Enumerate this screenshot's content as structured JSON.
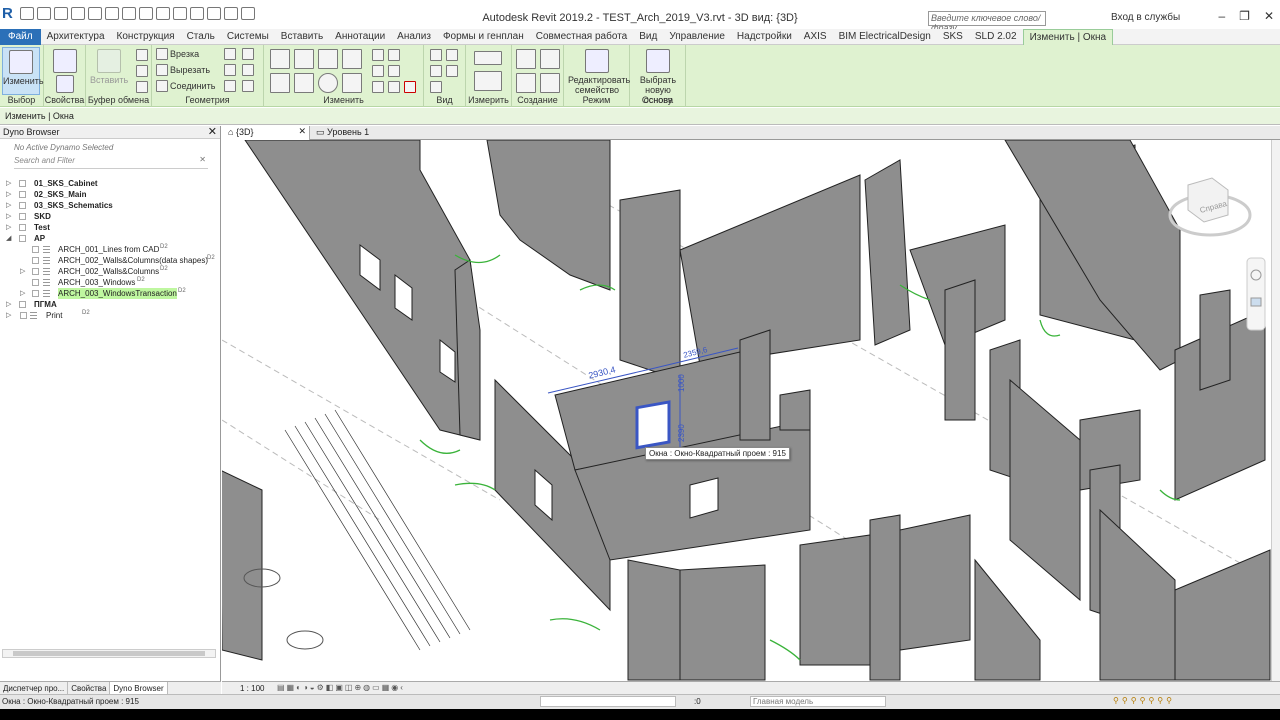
{
  "titlebar": {
    "title": "Autodesk Revit 2019.2 - TEST_Arch_2019_V3.rvt - 3D вид: {3D}",
    "search_placeholder": "Введите ключевое слово/фразу",
    "login": "Вход в службы"
  },
  "tabs": [
    "Файл",
    "Архитектура",
    "Конструкция",
    "Сталь",
    "Системы",
    "Вставить",
    "Аннотации",
    "Анализ",
    "Формы и генплан",
    "Совместная работа",
    "Вид",
    "Управление",
    "Надстройки",
    "AXIS",
    "BIM ElectricalDesign",
    "SKS",
    "SLD 2.02",
    "Изменить | Окна"
  ],
  "ribbon": {
    "modify": "Изменить",
    "select": "Выбор",
    "props": "Свойства",
    "paste": "Вставить",
    "clipboard": "Буфер обмена",
    "cut_join": "Врезка",
    "cut": "Вырезать",
    "join": "Соединить",
    "geometry": "Геометрия",
    "modify_grp": "Изменить",
    "view": "Вид",
    "measure": "Измерить",
    "create": "Создание",
    "edit_family": "Редактировать семейство",
    "mode": "Режим",
    "pick_host": "Выбрать новую основу",
    "host": "Основа"
  },
  "options_bar": "Изменить | Окна",
  "left_panel": {
    "title": "Dyno Browser",
    "no_active": "No Active Dynamo Selected",
    "filter": "Search and Filter",
    "tree": [
      {
        "label": "01_SKS_Cabinet",
        "bold": true,
        "level": 0
      },
      {
        "label": "02_SKS_Main",
        "bold": true,
        "level": 0
      },
      {
        "label": "03_SKS_Schematics",
        "bold": true,
        "level": 0
      },
      {
        "label": "SKD",
        "bold": true,
        "level": 0
      },
      {
        "label": "Test",
        "bold": true,
        "level": 0
      },
      {
        "label": "АР",
        "bold": true,
        "level": 0,
        "open": true
      },
      {
        "label": "ARCH_001_Lines from CAD",
        "level": 1,
        "tag": "D2"
      },
      {
        "label": "ARCH_002_Walls&Columns(data shapes)",
        "level": 1,
        "tag": "D2"
      },
      {
        "label": "ARCH_002_Walls&Columns",
        "level": 1,
        "tag": "D2",
        "arrow": true
      },
      {
        "label": "ARCH_003_Windows",
        "level": 1,
        "tag": "D2"
      },
      {
        "label": "ARCH_003_WindowsTransaction",
        "level": 1,
        "tag": "D2",
        "arrow": true,
        "highlight": true
      },
      {
        "label": "ПГМА",
        "bold": true,
        "level": 0
      },
      {
        "label": "Print",
        "level": 0,
        "tag": "D2",
        "leaf": true
      }
    ],
    "bottom_tabs": [
      "Диспетчер про...",
      "Свойства",
      "Dyno Browser"
    ]
  },
  "view_tabs": [
    "{3D}",
    "Уровень 1"
  ],
  "viewport": {
    "tooltip": "Окна : Окно-Квадратный проем : 915",
    "dim1": "2930,4",
    "dim2": "2359,6",
    "dim3": "1000",
    "dim4": "2390",
    "viewcube": "Справа"
  },
  "view_scale": "1 : 100",
  "status": {
    "text": "Окна : Окно-Квадратный проем : 915",
    "zero": ":0",
    "model": "Главная модель"
  }
}
